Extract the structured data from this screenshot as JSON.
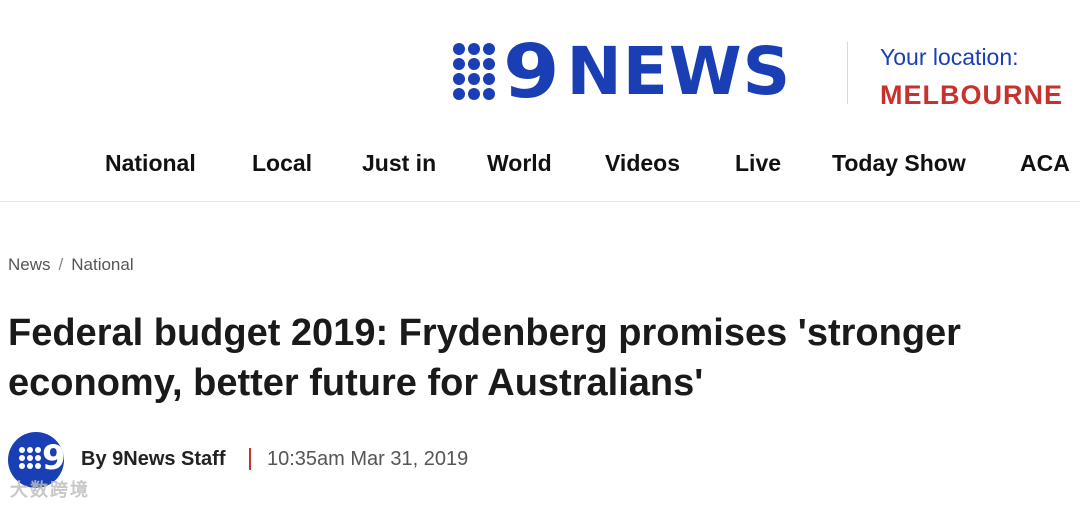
{
  "header": {
    "logo_number": "9",
    "logo_word": "NEWS",
    "brand_color": "#1a3fb5",
    "location_label": "Your location:",
    "location_city": "MELBOURNE",
    "location_color": "#c8322c"
  },
  "nav": {
    "items": [
      "National",
      "Local",
      "Just in",
      "World",
      "Videos",
      "Live",
      "Today Show",
      "ACA"
    ]
  },
  "breadcrumb": {
    "items": [
      "News",
      "National"
    ],
    "separator": "/"
  },
  "article": {
    "title": "Federal budget 2019: Frydenberg promises 'stronger economy, better future for Australians'",
    "author": "By 9News Staff",
    "date": "10:35am Mar 31, 2019"
  },
  "watermark": "大数跨境"
}
